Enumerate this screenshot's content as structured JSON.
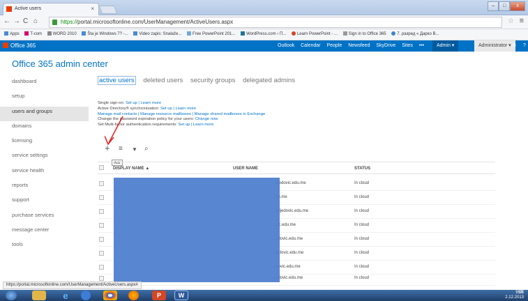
{
  "browser": {
    "tab_title": "Active users",
    "tab_close": "×",
    "url_scheme": "https://",
    "url_rest": "portal.microsoftonline.com/UserManagement/ActiveUsers.aspx",
    "bookmarks": [
      "Apps",
      "T-com",
      "WORD 2010",
      "Šta je Windows 7? -...",
      "Video zapis: Snalaže...",
      "Free PowerPoint 201...",
      "WordPress.com › П...",
      "Learn PowerPoint - ...",
      "Sign in to Office 365",
      "7. разред « Дарко В..."
    ],
    "status_url": "https://portal.microsoftonline.com/UserManagement/ActiveUsers.aspx#"
  },
  "suite_bar": {
    "brand": "Office 365",
    "links": [
      "Outlook",
      "Calendar",
      "People",
      "Newsfeed",
      "SkyDrive",
      "Sites",
      "•••"
    ],
    "admin_label": "Admin ▾",
    "user_label": "Administrator ▾",
    "gear": "⚙",
    "help": "?"
  },
  "page": {
    "title": "Office 365 admin center"
  },
  "sidebar": {
    "items": [
      {
        "label": "dashboard"
      },
      {
        "label": "setup"
      },
      {
        "label": "users and groups"
      },
      {
        "label": "domains"
      },
      {
        "label": "licensing"
      },
      {
        "label": "service settings"
      },
      {
        "label": "service health"
      },
      {
        "label": "reports"
      },
      {
        "label": "support"
      },
      {
        "label": "purchase services"
      },
      {
        "label": "message center"
      },
      {
        "label": "tools"
      }
    ],
    "active": "users and groups"
  },
  "pivots": {
    "active_users": "active users",
    "deleted_users": "deleted users",
    "security_groups": "security groups",
    "delegated_admins": "delegated admins"
  },
  "info": {
    "l1_pre": "Single sign-on: ",
    "l1_links": "Set up | Learn more",
    "l2_pre": "Active Directory® synchronization: ",
    "l2_links": "Set up | Learn more",
    "l3_links": "Manage mail contacts | Manage resource mailboxes | Manage shared mailboxes in Exchange",
    "l4_pre": "Change the password expiration policy for your users: ",
    "l4_links": "Change now",
    "l5_pre": "Set Multi-factor authentication requirements: ",
    "l5_links": "Set up | Learn more"
  },
  "toolbar": {
    "add_icon": "+",
    "bulk_icon": "≡",
    "filter_icon": "▼",
    "search_icon": "⌕",
    "tooltip": "Add"
  },
  "table": {
    "headers": {
      "display_name": "DISPLAY NAME ▲",
      "user_name": "USER NAME",
      "status": "STATUS"
    },
    "rows": [
      {
        "user": "...ajedovic.edu.me",
        "status": "In cloud"
      },
      {
        "user": "...du.me",
        "status": "In cloud"
      },
      {
        "user": "...adjedovic.edu.me",
        "status": "In cloud"
      },
      {
        "user": "...vic.edu.me",
        "status": "In cloud"
      },
      {
        "user": "...edovic.edu.me",
        "status": "In cloud"
      },
      {
        "user": "...jedovic.edu.me",
        "status": "In cloud"
      },
      {
        "user": "...dovic.edu.me",
        "status": "In cloud"
      },
      {
        "user": "...edovic.edu.me",
        "status": "In cloud"
      }
    ]
  },
  "taskbar": {
    "lang": "SR",
    "time": "9:01",
    "date": "2.12.2013"
  },
  "colors": {
    "accent": "#0072c6",
    "redaction": "#4f80cd",
    "annotation": "#e02020"
  }
}
